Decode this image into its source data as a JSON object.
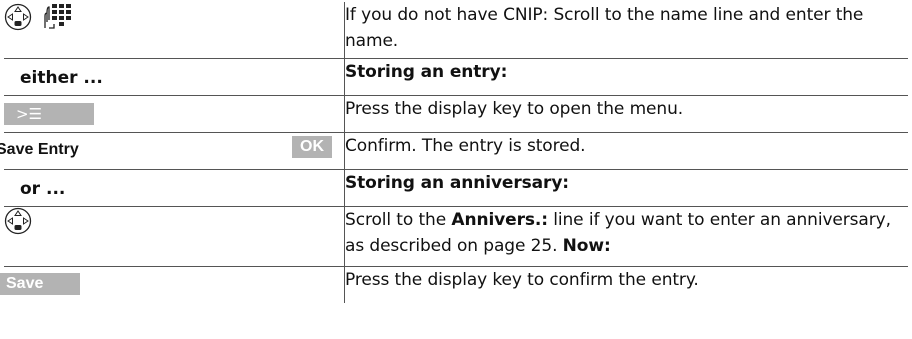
{
  "rows": [
    {
      "right_text": "If you do not have CNIP: Scroll to the name line and enter the name.",
      "left_icons": [
        "control-key-icon",
        "keypad-icon"
      ]
    },
    {
      "left_label": "either ...",
      "right_text": "Storing an entry:"
    },
    {
      "left_key": "",
      "left_key_icon": "menu-icon",
      "right_text": "Press the display key to open the menu."
    },
    {
      "left_label": "Save Entry",
      "left_key": "OK",
      "right_text": "Confirm. The entry is stored."
    },
    {
      "left_label": "or ...",
      "right_text": "Storing an anniversary:"
    },
    {
      "left_icons": [
        "control-key-icon"
      ],
      "right_parts": {
        "p1": "Scroll to the ",
        "bold1": "Annivers.:",
        "p2": " line if you want to enter an anniversary, as described on page 25. ",
        "bold2": "Now:"
      }
    },
    {
      "left_key": "Save",
      "right_text": "Press the display key to confirm the entry."
    }
  ],
  "colors": {
    "display_key": "#b3b3b3",
    "rule": "#555555",
    "text": "#111111"
  }
}
